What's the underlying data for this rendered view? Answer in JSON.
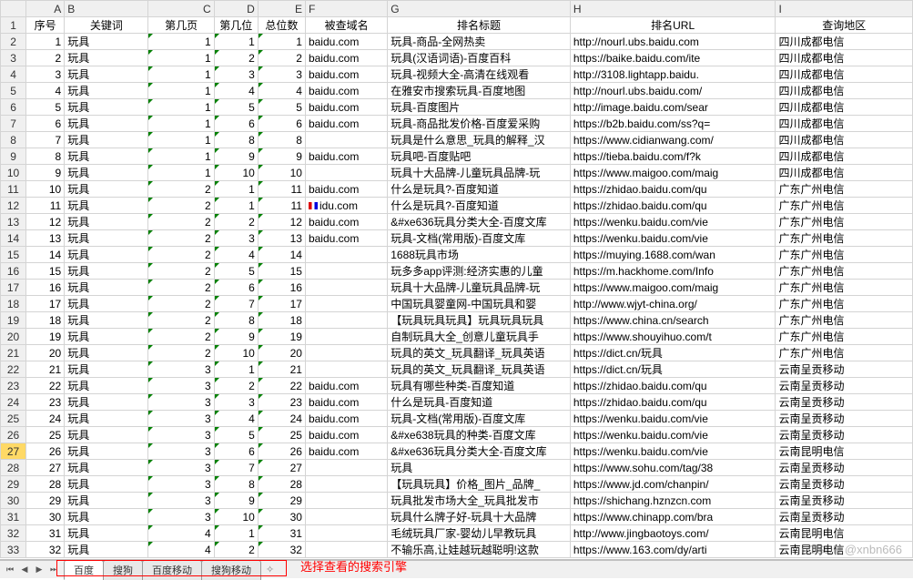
{
  "columns": [
    "",
    "A",
    "B",
    "C",
    "D",
    "E",
    "F",
    "G",
    "H",
    "I"
  ],
  "headers": {
    "A": "序号",
    "B": "关键词",
    "C": "第几页",
    "D": "第几位",
    "E": "总位数",
    "F": "被查域名",
    "G": "排名标题",
    "H": "排名URL",
    "I": "查询地区"
  },
  "selected_row": 27,
  "rows": [
    {
      "n": 2,
      "A": "1",
      "B": "玩具",
      "C": "1",
      "D": "1",
      "E": "1",
      "F": "baidu.com",
      "G": "玩具-商品-全网热卖",
      "H": "http://nourl.ubs.baidu.com",
      "I": "四川成都电信"
    },
    {
      "n": 3,
      "A": "2",
      "B": "玩具",
      "C": "1",
      "D": "2",
      "E": "2",
      "F": "baidu.com",
      "G": "玩具(汉语词语)-百度百科",
      "H": "https://baike.baidu.com/ite",
      "I": "四川成都电信"
    },
    {
      "n": 4,
      "A": "3",
      "B": "玩具",
      "C": "1",
      "D": "3",
      "E": "3",
      "F": "baidu.com",
      "G": "玩具-视频大全-高清在线观看",
      "H": "http://3108.lightapp.baidu.",
      "I": "四川成都电信"
    },
    {
      "n": 5,
      "A": "4",
      "B": "玩具",
      "C": "1",
      "D": "4",
      "E": "4",
      "F": "baidu.com",
      "G": "在雅安市搜索玩具-百度地图",
      "H": "http://nourl.ubs.baidu.com/",
      "I": "四川成都电信"
    },
    {
      "n": 6,
      "A": "5",
      "B": "玩具",
      "C": "1",
      "D": "5",
      "E": "5",
      "F": "baidu.com",
      "G": "玩具-百度图片",
      "H": "http://image.baidu.com/sear",
      "I": "四川成都电信"
    },
    {
      "n": 7,
      "A": "6",
      "B": "玩具",
      "C": "1",
      "D": "6",
      "E": "6",
      "F": "baidu.com",
      "G": "玩具-商品批发价格-百度爱采购",
      "H": "https://b2b.baidu.com/ss?q=",
      "I": "四川成都电信"
    },
    {
      "n": 8,
      "A": "7",
      "B": "玩具",
      "C": "1",
      "D": "8",
      "E": "8",
      "F": "",
      "G": "玩具是什么意思_玩具的解释_汉",
      "H": "https://www.cidianwang.com/",
      "I": "四川成都电信"
    },
    {
      "n": 9,
      "A": "8",
      "B": "玩具",
      "C": "1",
      "D": "9",
      "E": "9",
      "F": "baidu.com",
      "G": "玩具吧-百度贴吧",
      "H": "https://tieba.baidu.com/f?k",
      "I": "四川成都电信"
    },
    {
      "n": 10,
      "A": "9",
      "B": "玩具",
      "C": "1",
      "D": "10",
      "E": "10",
      "F": "",
      "G": "玩具十大品牌-儿童玩具品牌-玩",
      "H": "https://www.maigoo.com/maig",
      "I": "四川成都电信"
    },
    {
      "n": 11,
      "A": "10",
      "B": "玩具",
      "C": "2",
      "D": "1",
      "E": "11",
      "F": "baidu.com",
      "G": "什么是玩具?-百度知道",
      "H": "https://zhidao.baidu.com/qu",
      "I": "广东广州电信"
    },
    {
      "n": 12,
      "A": "11",
      "B": "玩具",
      "C": "2",
      "D": "1",
      "E": "11",
      "F": "idu.com",
      "G": "什么是玩具?-百度知道",
      "H": "https://zhidao.baidu.com/qu",
      "I": "广东广州电信",
      "flag": true
    },
    {
      "n": 13,
      "A": "12",
      "B": "玩具",
      "C": "2",
      "D": "2",
      "E": "12",
      "F": "baidu.com",
      "G": "&#xe636玩具分类大全-百度文库",
      "H": "https://wenku.baidu.com/vie",
      "I": "广东广州电信"
    },
    {
      "n": 14,
      "A": "13",
      "B": "玩具",
      "C": "2",
      "D": "3",
      "E": "13",
      "F": "baidu.com",
      "G": "玩具-文档(常用版)-百度文库",
      "H": "https://wenku.baidu.com/vie",
      "I": "广东广州电信"
    },
    {
      "n": 15,
      "A": "14",
      "B": "玩具",
      "C": "2",
      "D": "4",
      "E": "14",
      "F": "",
      "G": "1688玩具市场",
      "H": "https://muying.1688.com/wan",
      "I": "广东广州电信"
    },
    {
      "n": 16,
      "A": "15",
      "B": "玩具",
      "C": "2",
      "D": "5",
      "E": "15",
      "F": "",
      "G": "玩多多app评测:经济实惠的儿童",
      "H": "https://m.hackhome.com/Info",
      "I": "广东广州电信"
    },
    {
      "n": 17,
      "A": "16",
      "B": "玩具",
      "C": "2",
      "D": "6",
      "E": "16",
      "F": "",
      "G": "玩具十大品牌-儿童玩具品牌-玩",
      "H": "https://www.maigoo.com/maig",
      "I": "广东广州电信"
    },
    {
      "n": 18,
      "A": "17",
      "B": "玩具",
      "C": "2",
      "D": "7",
      "E": "17",
      "F": "",
      "G": "中国玩具婴童网-中国玩具和婴",
      "H": "http://www.wjyt-china.org/",
      "I": "广东广州电信"
    },
    {
      "n": 19,
      "A": "18",
      "B": "玩具",
      "C": "2",
      "D": "8",
      "E": "18",
      "F": "",
      "G": "【玩具玩具玩具】玩具玩具玩具",
      "H": "https://www.china.cn/search",
      "I": "广东广州电信"
    },
    {
      "n": 20,
      "A": "19",
      "B": "玩具",
      "C": "2",
      "D": "9",
      "E": "19",
      "F": "",
      "G": "自制玩具大全_创意儿童玩具手",
      "H": "https://www.shouyihuo.com/t",
      "I": "广东广州电信"
    },
    {
      "n": 21,
      "A": "20",
      "B": "玩具",
      "C": "2",
      "D": "10",
      "E": "20",
      "F": "",
      "G": "玩具的英文_玩具翻译_玩具英语",
      "H": "https://dict.cn/玩具",
      "I": "广东广州电信"
    },
    {
      "n": 22,
      "A": "21",
      "B": "玩具",
      "C": "3",
      "D": "1",
      "E": "21",
      "F": "",
      "G": "玩具的英文_玩具翻译_玩具英语",
      "H": "https://dict.cn/玩具",
      "I": "云南呈贡移动"
    },
    {
      "n": 23,
      "A": "22",
      "B": "玩具",
      "C": "3",
      "D": "2",
      "E": "22",
      "F": "baidu.com",
      "G": "玩具有哪些种类-百度知道",
      "H": "https://zhidao.baidu.com/qu",
      "I": "云南呈贡移动"
    },
    {
      "n": 24,
      "A": "23",
      "B": "玩具",
      "C": "3",
      "D": "3",
      "E": "23",
      "F": "baidu.com",
      "G": "什么是玩具-百度知道",
      "H": "https://zhidao.baidu.com/qu",
      "I": "云南呈贡移动"
    },
    {
      "n": 25,
      "A": "24",
      "B": "玩具",
      "C": "3",
      "D": "4",
      "E": "24",
      "F": "baidu.com",
      "G": "玩具-文档(常用版)-百度文库",
      "H": "https://wenku.baidu.com/vie",
      "I": "云南呈贡移动"
    },
    {
      "n": 26,
      "A": "25",
      "B": "玩具",
      "C": "3",
      "D": "5",
      "E": "25",
      "F": "baidu.com",
      "G": "&#xe638玩具的种类-百度文库",
      "H": "https://wenku.baidu.com/vie",
      "I": "云南呈贡移动"
    },
    {
      "n": 27,
      "A": "26",
      "B": "玩具",
      "C": "3",
      "D": "6",
      "E": "26",
      "F": "baidu.com",
      "G": "&#xe636玩具分类大全-百度文库",
      "H": "https://wenku.baidu.com/vie",
      "I": "云南昆明电信"
    },
    {
      "n": 28,
      "A": "27",
      "B": "玩具",
      "C": "3",
      "D": "7",
      "E": "27",
      "F": "",
      "G": "玩具",
      "H": "https://www.sohu.com/tag/38",
      "I": "云南呈贡移动"
    },
    {
      "n": 29,
      "A": "28",
      "B": "玩具",
      "C": "3",
      "D": "8",
      "E": "28",
      "F": "",
      "G": "【玩具玩具】价格_图片_品牌_",
      "H": "https://www.jd.com/chanpin/",
      "I": "云南呈贡移动"
    },
    {
      "n": 30,
      "A": "29",
      "B": "玩具",
      "C": "3",
      "D": "9",
      "E": "29",
      "F": "",
      "G": "玩具批发市场大全_玩具批发市",
      "H": "https://shichang.hznzcn.com",
      "I": "云南呈贡移动"
    },
    {
      "n": 31,
      "A": "30",
      "B": "玩具",
      "C": "3",
      "D": "10",
      "E": "30",
      "F": "",
      "G": "玩具什么牌子好-玩具十大品牌",
      "H": "https://www.chinapp.com/bra",
      "I": "云南呈贡移动"
    },
    {
      "n": 32,
      "A": "31",
      "B": "玩具",
      "C": "4",
      "D": "1",
      "E": "31",
      "F": "",
      "G": "毛绒玩具厂家-婴幼儿早教玩具",
      "H": "http://www.jingbaotoys.com/",
      "I": "云南昆明电信"
    },
    {
      "n": 33,
      "A": "32",
      "B": "玩具",
      "C": "4",
      "D": "2",
      "E": "32",
      "F": "",
      "G": "不输乐高,让娃越玩越聪明!这款",
      "H": "https://www.163.com/dy/arti",
      "I": "云南昆明电信"
    }
  ],
  "tabs": [
    {
      "label": "百度",
      "active": true
    },
    {
      "label": "搜狗",
      "active": false
    },
    {
      "label": "百度移动",
      "active": false
    },
    {
      "label": "搜狗移动",
      "active": false
    }
  ],
  "annotation": "选择查看的搜索引擎",
  "watermark": "CSDN @xnbn666"
}
